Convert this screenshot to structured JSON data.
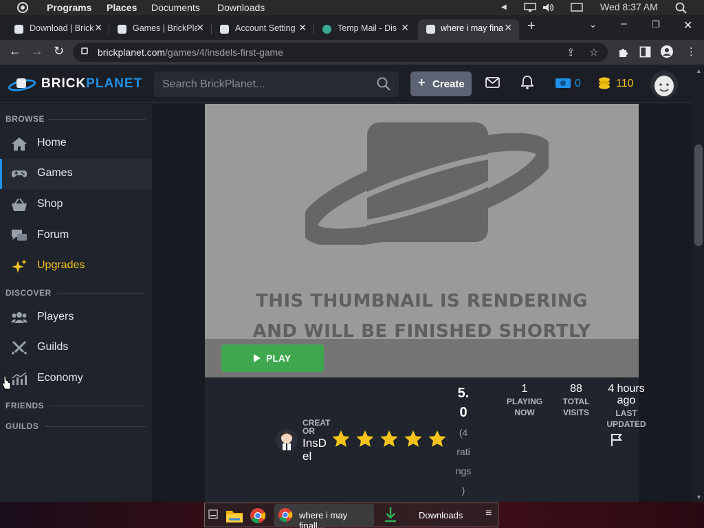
{
  "os": {
    "menus": [
      "Programs",
      "Places",
      "Documents",
      "Downloads"
    ],
    "clock": "Wed 8:37 AM"
  },
  "browser": {
    "tabs": [
      {
        "title": "Download | Brick"
      },
      {
        "title": "Games | BrickPla"
      },
      {
        "title": "Account Setting"
      },
      {
        "title": "Temp Mail - Dis"
      },
      {
        "title": "where i may fina"
      }
    ],
    "url_host": "brickplanet.com",
    "url_path": "/games/4/insdels-first-game"
  },
  "site": {
    "brand_a": "BRICK",
    "brand_b": "PLANET",
    "search_placeholder": "Search BrickPlanet...",
    "create_label": "Create",
    "credits": "0",
    "bits": "110",
    "colors": {
      "accent": "#1f91e6",
      "play": "#3fa84e",
      "upgrade": "#f3c31c",
      "star": "#f3c31c"
    }
  },
  "sidebar": {
    "browse_header": "BROWSE",
    "browse": [
      {
        "label": "Home",
        "icon": "home-icon"
      },
      {
        "label": "Games",
        "icon": "gamepad-icon"
      },
      {
        "label": "Shop",
        "icon": "basket-icon"
      },
      {
        "label": "Forum",
        "icon": "chat-icon"
      },
      {
        "label": "Upgrades",
        "icon": "sparkle-icon"
      }
    ],
    "discover_header": "DISCOVER",
    "discover": [
      {
        "label": "Players",
        "icon": "users-icon"
      },
      {
        "label": "Guilds",
        "icon": "swords-icon"
      },
      {
        "label": "Economy",
        "icon": "chart-icon"
      }
    ],
    "friends_header": "FRIENDS",
    "guilds_header": "GUILDS"
  },
  "game": {
    "thumb_line1": "THIS THUMBNAIL IS RENDERING",
    "thumb_line2": "AND WILL BE FINISHED SHORTLY",
    "play_label": "PLAY",
    "creator_label": "CREAT OR",
    "creator_name": "InsD el",
    "rating_value": "5. 0",
    "rating_count": "(4 rati ngs )",
    "stars": 5,
    "playing_value": "1",
    "playing_label": "PLAYING NOW",
    "visits_value": "88",
    "visits_label": "TOTAL VISITS",
    "updated_value": "4 hours ago",
    "updated_label": "LAST UPDATED"
  },
  "taskbar": {
    "chrome_window": "where i may finall...",
    "downloads_window": "Downloads"
  }
}
